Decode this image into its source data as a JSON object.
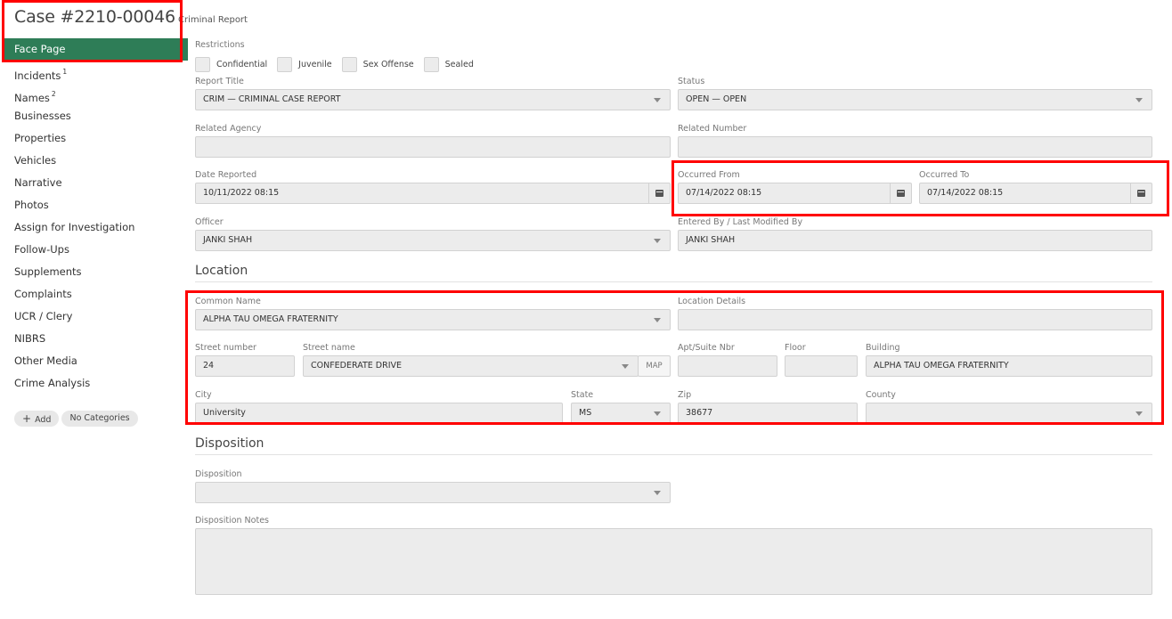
{
  "case": {
    "title": "Case #2210-00046",
    "subtitle": "Criminal Report"
  },
  "nav": [
    {
      "label": "Face Page",
      "badge": ""
    },
    {
      "label": "Incidents",
      "badge": "1"
    },
    {
      "label": "Names",
      "badge": "2"
    },
    {
      "label": "Businesses",
      "badge": ""
    },
    {
      "label": "Properties",
      "badge": ""
    },
    {
      "label": "Vehicles",
      "badge": ""
    },
    {
      "label": "Narrative",
      "badge": ""
    },
    {
      "label": "Photos",
      "badge": ""
    },
    {
      "label": "Assign for Investigation",
      "badge": ""
    },
    {
      "label": "Follow-Ups",
      "badge": ""
    },
    {
      "label": "Supplements",
      "badge": ""
    },
    {
      "label": "Complaints",
      "badge": ""
    },
    {
      "label": "UCR / Clery",
      "badge": ""
    },
    {
      "label": "NIBRS",
      "badge": ""
    },
    {
      "label": "Other Media",
      "badge": ""
    },
    {
      "label": "Crime Analysis",
      "badge": ""
    }
  ],
  "categories": {
    "add_label": "Add",
    "none_label": "No Categories"
  },
  "restrictions": {
    "label": "Restrictions",
    "options": [
      "Confidential",
      "Juvenile",
      "Sex Offense",
      "Sealed"
    ]
  },
  "report": {
    "title_label": "Report Title",
    "title_value": "CRIM — CRIMINAL CASE REPORT",
    "status_label": "Status",
    "status_value": "OPEN — OPEN",
    "agency_label": "Related Agency",
    "agency_value": "",
    "number_label": "Related Number",
    "number_value": "",
    "date_reported_label": "Date Reported",
    "date_reported_value": "10/11/2022 08:15",
    "occurred_from_label": "Occurred From",
    "occurred_from_value": "07/14/2022 08:15",
    "occurred_to_label": "Occurred To",
    "occurred_to_value": "07/14/2022 08:15",
    "officer_label": "Officer",
    "officer_value": "JANKI SHAH",
    "entered_by_label": "Entered By / Last Modified By",
    "entered_by_value": "JANKI SHAH"
  },
  "location": {
    "heading": "Location",
    "common_name_label": "Common Name",
    "common_name_value": "ALPHA TAU OMEGA FRATERNITY",
    "details_label": "Location Details",
    "details_value": "",
    "street_number_label": "Street number",
    "street_number_value": "24",
    "street_name_label": "Street name",
    "street_name_value": "CONFEDERATE DRIVE",
    "map_label": "MAP",
    "apt_label": "Apt/Suite Nbr",
    "apt_value": "",
    "floor_label": "Floor",
    "floor_value": "",
    "building_label": "Building",
    "building_value": "ALPHA TAU OMEGA FRATERNITY",
    "city_label": "City",
    "city_value": "University",
    "state_label": "State",
    "state_value": "MS",
    "zip_label": "Zip",
    "zip_value": "38677",
    "county_label": "County",
    "county_value": ""
  },
  "disposition": {
    "heading": "Disposition",
    "disposition_label": "Disposition",
    "disposition_value": "",
    "notes_label": "Disposition Notes",
    "notes_value": ""
  },
  "colors": {
    "active_nav": "#2e7d57",
    "highlight": "#ff0000",
    "field_bg": "#ececec"
  }
}
